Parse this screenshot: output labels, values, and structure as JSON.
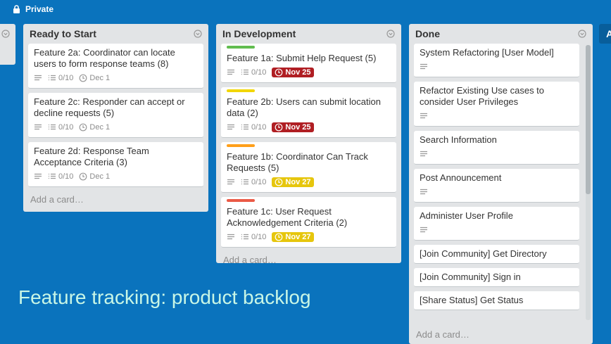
{
  "header": {
    "visibility_label": "Private",
    "visibility_icon": "lock-icon"
  },
  "colors": {
    "board_background": "#0a73bd",
    "due_overdue": "#b01e23",
    "due_soon": "#e6c60d",
    "label_green": "#61bd4f",
    "label_yellow": "#f2d600",
    "label_orange": "#ff9f1a",
    "label_red": "#eb5a46",
    "caption_text": "#c8f6e6"
  },
  "lists": [
    {
      "title": "Ready to Start",
      "add_card": "Add a card…",
      "cards": [
        {
          "title": "Feature 2a: Coordinator can locate users to form response teams (8)",
          "checklist": "0/10",
          "due": "Dec 1"
        },
        {
          "title": "Feature 2c: Responder can accept or decline requests (5)",
          "checklist": "0/10",
          "due": "Dec 1"
        },
        {
          "title": "Feature 2d: Response Team Acceptance Criteria (3)",
          "checklist": "0/10",
          "due": "Dec 1"
        }
      ]
    },
    {
      "title": "In Development",
      "add_card": "Add a card…",
      "cards": [
        {
          "title": "Feature 1a: Submit Help Request (5)",
          "checklist": "0/10",
          "due": "Nov 25",
          "label_color": "green",
          "due_state": "overdue"
        },
        {
          "title": "Feature 2b: Users can submit location data (2)",
          "checklist": "0/10",
          "due": "Nov 25",
          "label_color": "yellow",
          "due_state": "overdue"
        },
        {
          "title": "Feature 1b: Coordinator Can Track Requests (5)",
          "checklist": "0/10",
          "due": "Nov 27",
          "label_color": "orange",
          "due_state": "soon"
        },
        {
          "title": "Feature 1c: User Request Acknowledgement Criteria (2)",
          "checklist": "0/10",
          "due": "Nov 27",
          "label_color": "red",
          "due_state": "soon"
        }
      ]
    },
    {
      "title": "Done",
      "add_card": "Add a card…",
      "cards": [
        {
          "title": "System Refactoring [User Model]"
        },
        {
          "title": "Refactor Existing Use cases to consider User Privileges"
        },
        {
          "title": "Search Information"
        },
        {
          "title": "Post Announcement"
        },
        {
          "title": "Administer User Profile"
        },
        {
          "title": "[Join Community] Get Directory"
        },
        {
          "title": "[Join Community] Sign in"
        },
        {
          "title": "[Share Status] Get Status"
        }
      ]
    }
  ],
  "add_list_stub": "A",
  "caption": "Feature tracking: product backlog"
}
